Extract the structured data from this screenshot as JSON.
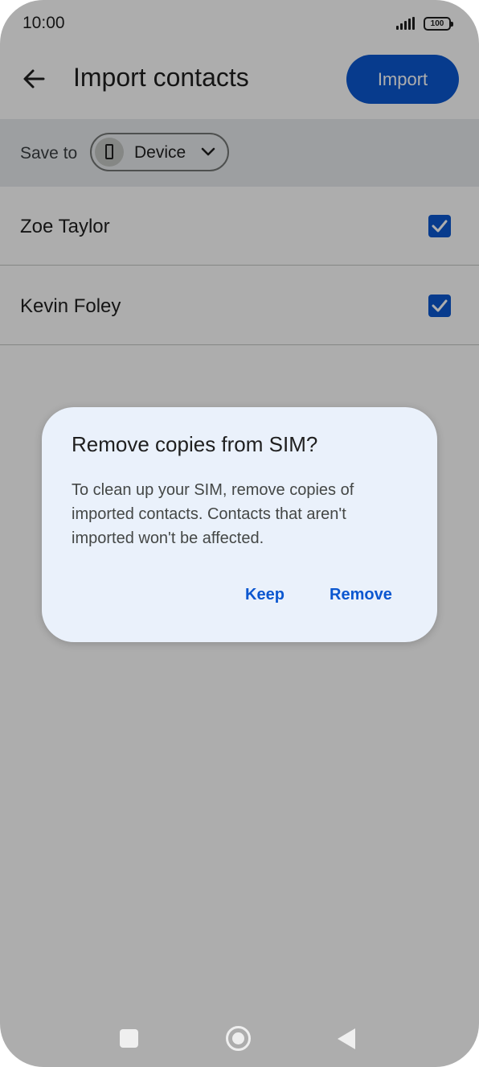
{
  "status_bar": {
    "time": "10:00",
    "battery": "100"
  },
  "app_bar": {
    "back_icon": "arrow-left-icon",
    "title": "Import contacts",
    "import_label": "Import"
  },
  "save_to": {
    "label": "Save to",
    "device_icon": "phone-icon",
    "device_label": "Device",
    "chevron_icon": "chevron-down-icon"
  },
  "contacts": [
    {
      "name": "Zoe Taylor",
      "checked": true
    },
    {
      "name": "Kevin Foley",
      "checked": true
    }
  ],
  "dialog": {
    "title": "Remove copies from SIM?",
    "body": "To clean up your SIM, remove copies of imported contacts. Contacts that aren't imported won't be affected.",
    "keep_label": "Keep",
    "remove_label": "Remove"
  },
  "colors": {
    "accent": "#0b57d0",
    "dialog_bg": "#eaf1fb",
    "scrim": "rgba(0,0,0,0.32)"
  }
}
